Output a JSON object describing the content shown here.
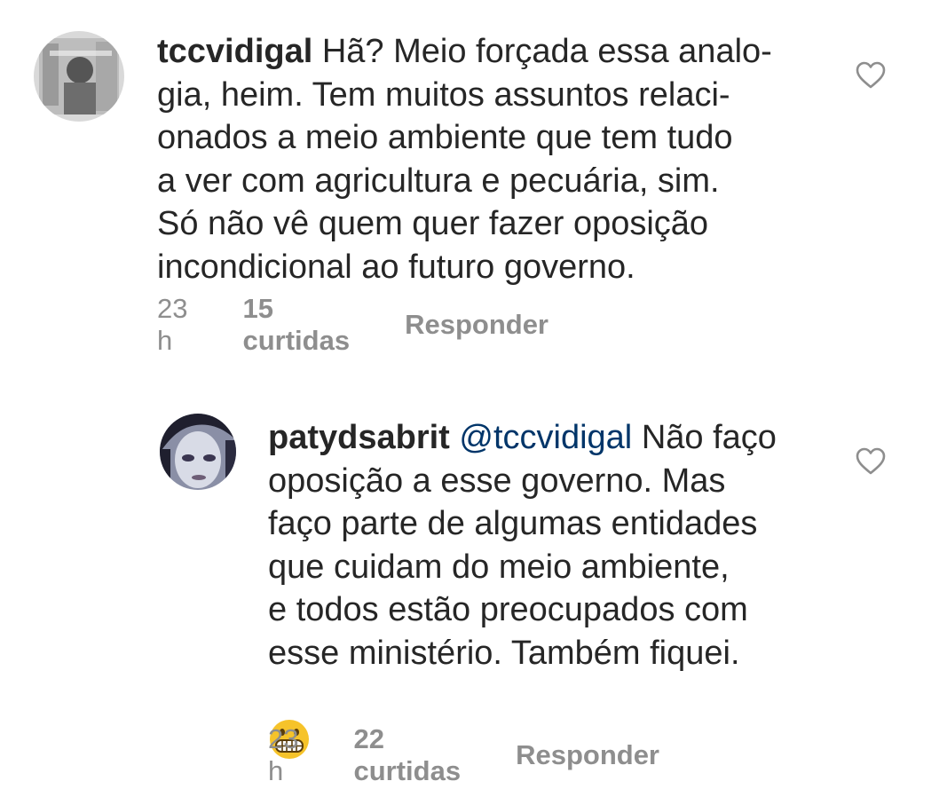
{
  "comments": [
    {
      "username": "tccvidigal",
      "lines": [
        " Hã? Meio forçada essa analo-",
        "gia, heim. Tem muitos assuntos relaci-",
        "onados a meio ambiente que tem tudo",
        "a ver com agricultura e pecuária, sim.",
        "Só não vê quem quer fazer oposição",
        "incondicional ao futuro governo."
      ],
      "time": "23 h",
      "likes": "15 curtidas",
      "reply": "Responder"
    },
    {
      "username": "patydsabrit",
      "mention": "@tccvidigal",
      "first_line_rest": " Não faço",
      "lines": [
        "oposição a esse governo. Mas",
        "faço parte de algumas entidades",
        "que cuidam do meio ambiente,",
        "e todos estão preocupados com",
        "esse ministério. Também fiquei."
      ],
      "emoji": "grimacing-face",
      "time": "23 h",
      "likes": "22 curtidas",
      "reply": "Responder"
    }
  ],
  "colors": {
    "text": "#262626",
    "meta": "#8e8e8e",
    "mention": "#003569",
    "emoji": "#f6c32a"
  }
}
